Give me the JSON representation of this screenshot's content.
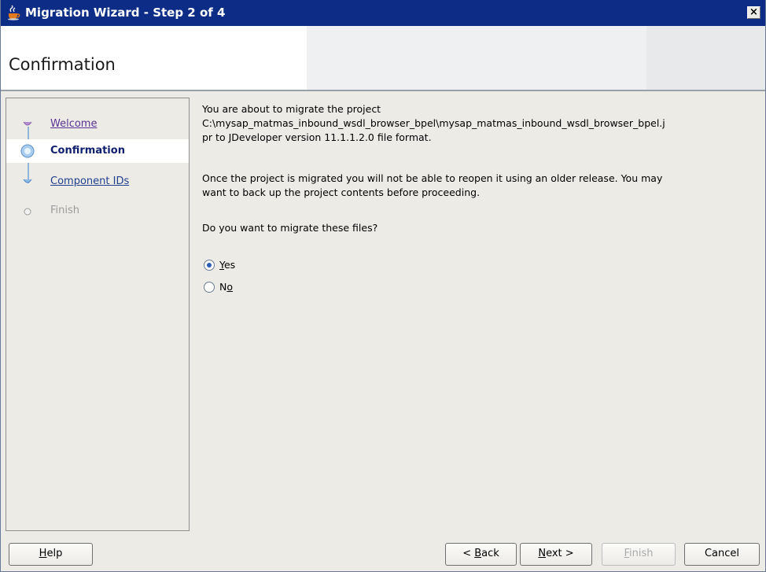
{
  "window": {
    "title": "Migration Wizard - Step 2 of 4",
    "close_label": "×"
  },
  "header": {
    "title": "Confirmation"
  },
  "nav": {
    "items": [
      {
        "label": "Welcome",
        "state": "visited"
      },
      {
        "label": "Confirmation",
        "state": "current"
      },
      {
        "label": "Component IDs",
        "state": "link"
      },
      {
        "label": "Finish",
        "state": "disabled"
      }
    ]
  },
  "content": {
    "para1_line1": "You are about to migrate the project",
    "para1_line2": "C:\\mysap_matmas_inbound_wsdl_browser_bpel\\mysap_matmas_inbound_wsdl_browser_bpel.j",
    "para1_line3": "pr to JDeveloper version 11.1.1.2.0 file format.",
    "para2_line1": "Once the project is migrated you will not be able to reopen it using an older release. You may",
    "para2_line2": "want to back up the project contents before proceeding.",
    "question": "Do you want to migrate these files?",
    "options": [
      {
        "label_mnemonic": "Y",
        "label_rest": "es",
        "selected": true
      },
      {
        "label_pre": "N",
        "label_mnemonic": "o",
        "selected": false
      }
    ]
  },
  "buttons": {
    "help": {
      "mnemonic": "H",
      "rest": "elp"
    },
    "back": {
      "pre": "< ",
      "mnemonic": "B",
      "rest": "ack"
    },
    "next": {
      "mnemonic": "N",
      "rest": "ext >"
    },
    "finish": {
      "mnemonic": "F",
      "rest": "inish",
      "enabled": false
    },
    "cancel": "Cancel"
  },
  "colors": {
    "titlebar": "#0c2c86",
    "accent": "#2a5cb8",
    "link": "#5a3296"
  }
}
